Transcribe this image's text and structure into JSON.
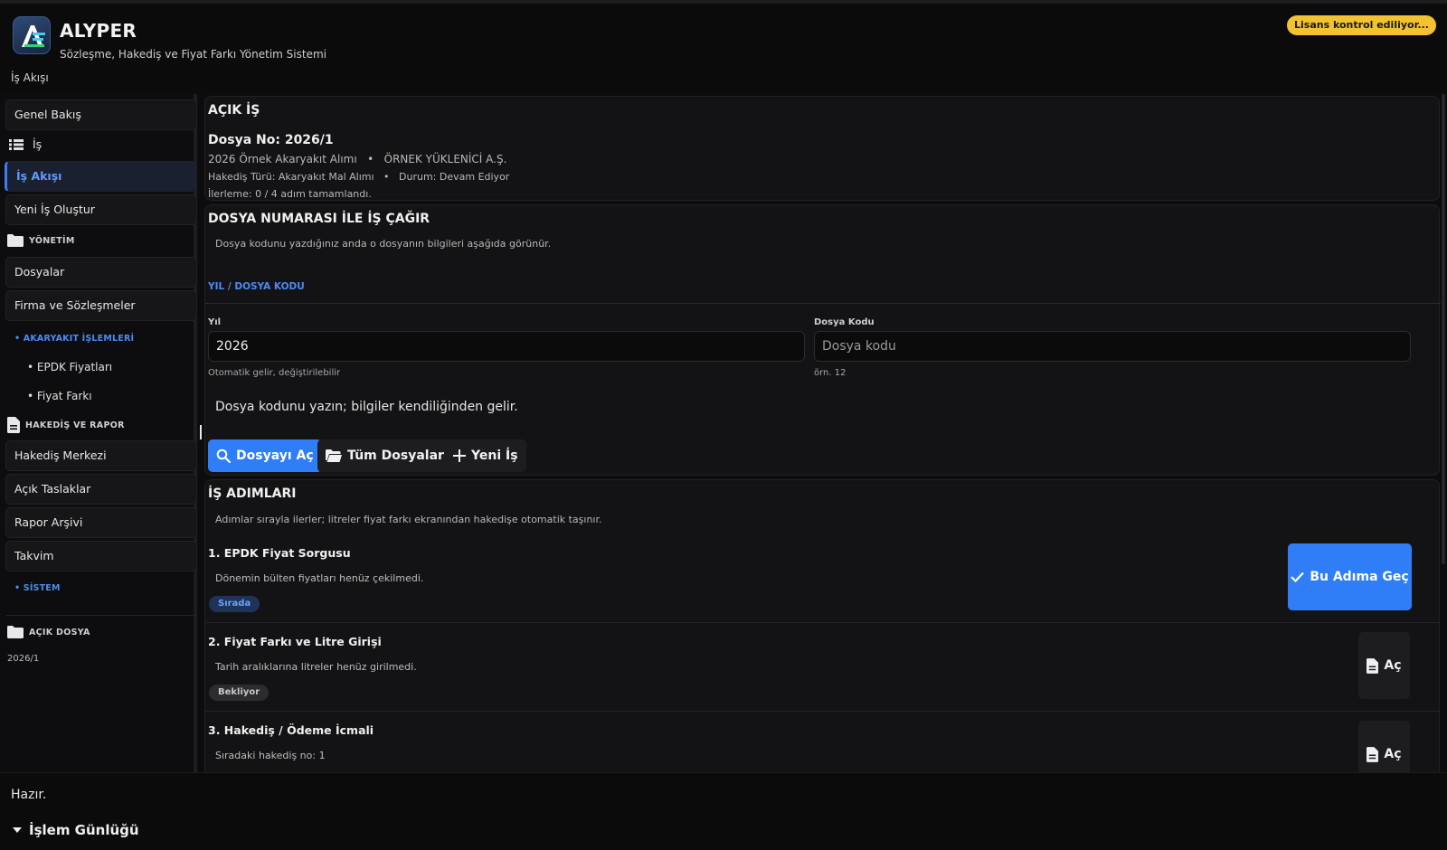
{
  "app": {
    "title": "ALYPER",
    "subtitle": "Sözleşme, Hakediş ve Fiyat Farkı Yönetim Sistemi",
    "breadcrumb": "İş Akışı",
    "license_badge": "Lisans kontrol ediliyor..."
  },
  "sidebar": {
    "overview": "Genel Bakış",
    "work_section": "İş",
    "workflow": "İş Akışı",
    "new_work": "Yeni İş Oluştur",
    "management_section": "YÖNETİM",
    "files": "Dosyalar",
    "companies": "Firma ve Sözleşmeler",
    "fuel_section": "• AKARYAKIT İŞLEMLERİ",
    "epdk": "• EPDK Fiyatları",
    "price_diff": "• Fiyat Farkı",
    "report_section": "HAKEDİŞ VE RAPOR",
    "progress_center": "Hakediş Merkezi",
    "open_drafts": "Açık Taslaklar",
    "report_archive": "Rapor Arşivi",
    "calendar": "Takvim",
    "system_section": "• SİSTEM",
    "open_file_section": "AÇIK DOSYA",
    "open_file_value": "2026/1"
  },
  "open_work": {
    "title": "AÇIK İŞ",
    "file_no": "Dosya No: 2026/1",
    "line1": "2026 Örnek Akaryakıt Alımı   •   ÖRNEK YÜKLENİCİ A.Ş.",
    "line2": "Hakediş Türü: Akaryakıt Mal Alımı   •   Durum: Devam Ediyor",
    "line3": "İlerleme: 0 / 4 adım tamamlandı."
  },
  "file_lookup": {
    "title": "DOSYA NUMARASI İLE İŞ ÇAĞIR",
    "description": "Dosya kodunu yazdığınız anda o dosyanın bilgileri aşağıda görünür.",
    "group_label": "YIL / DOSYA KODU",
    "year_label": "Yıl",
    "year_value": "2026",
    "year_hint": "Otomatik gelir, değiştirilebilir",
    "code_label": "Dosya Kodu",
    "code_placeholder": "Dosya kodu",
    "code_hint": "örn. 12",
    "info_text": "Dosya kodunu yazın; bilgiler kendiliğinden gelir.",
    "btn_open": "Dosyayı Aç",
    "btn_all": "Tüm Dosyalar",
    "btn_new": "Yeni İş"
  },
  "steps": {
    "title": "İŞ ADIMLARI",
    "description": "Adımlar sırayla ilerler; litreler fiyat farkı ekranından hakedişe otomatik taşınır.",
    "items": [
      {
        "title": "1. EPDK Fiyat Sorgusu",
        "desc": "Dönemin bülten fiyatları henüz çekilmedi.",
        "badge": "Sırada",
        "action": "Bu Adıma Geç"
      },
      {
        "title": "2. Fiyat Farkı ve Litre Girişi",
        "desc": "Tarih aralıklarına litreler henüz girilmedi.",
        "badge": "Bekliyor",
        "action": "Aç"
      },
      {
        "title": "3. Hakediş / Ödeme İcmali",
        "desc": "Sıradaki hakediş no: 1",
        "action": "Aç"
      }
    ]
  },
  "footer": {
    "status": "Hazır.",
    "log_label": "İşlem Günlüğü"
  },
  "colors": {
    "accent": "#2f7ef7",
    "accent_text": "#4c8af5",
    "license": "#f2c230"
  }
}
